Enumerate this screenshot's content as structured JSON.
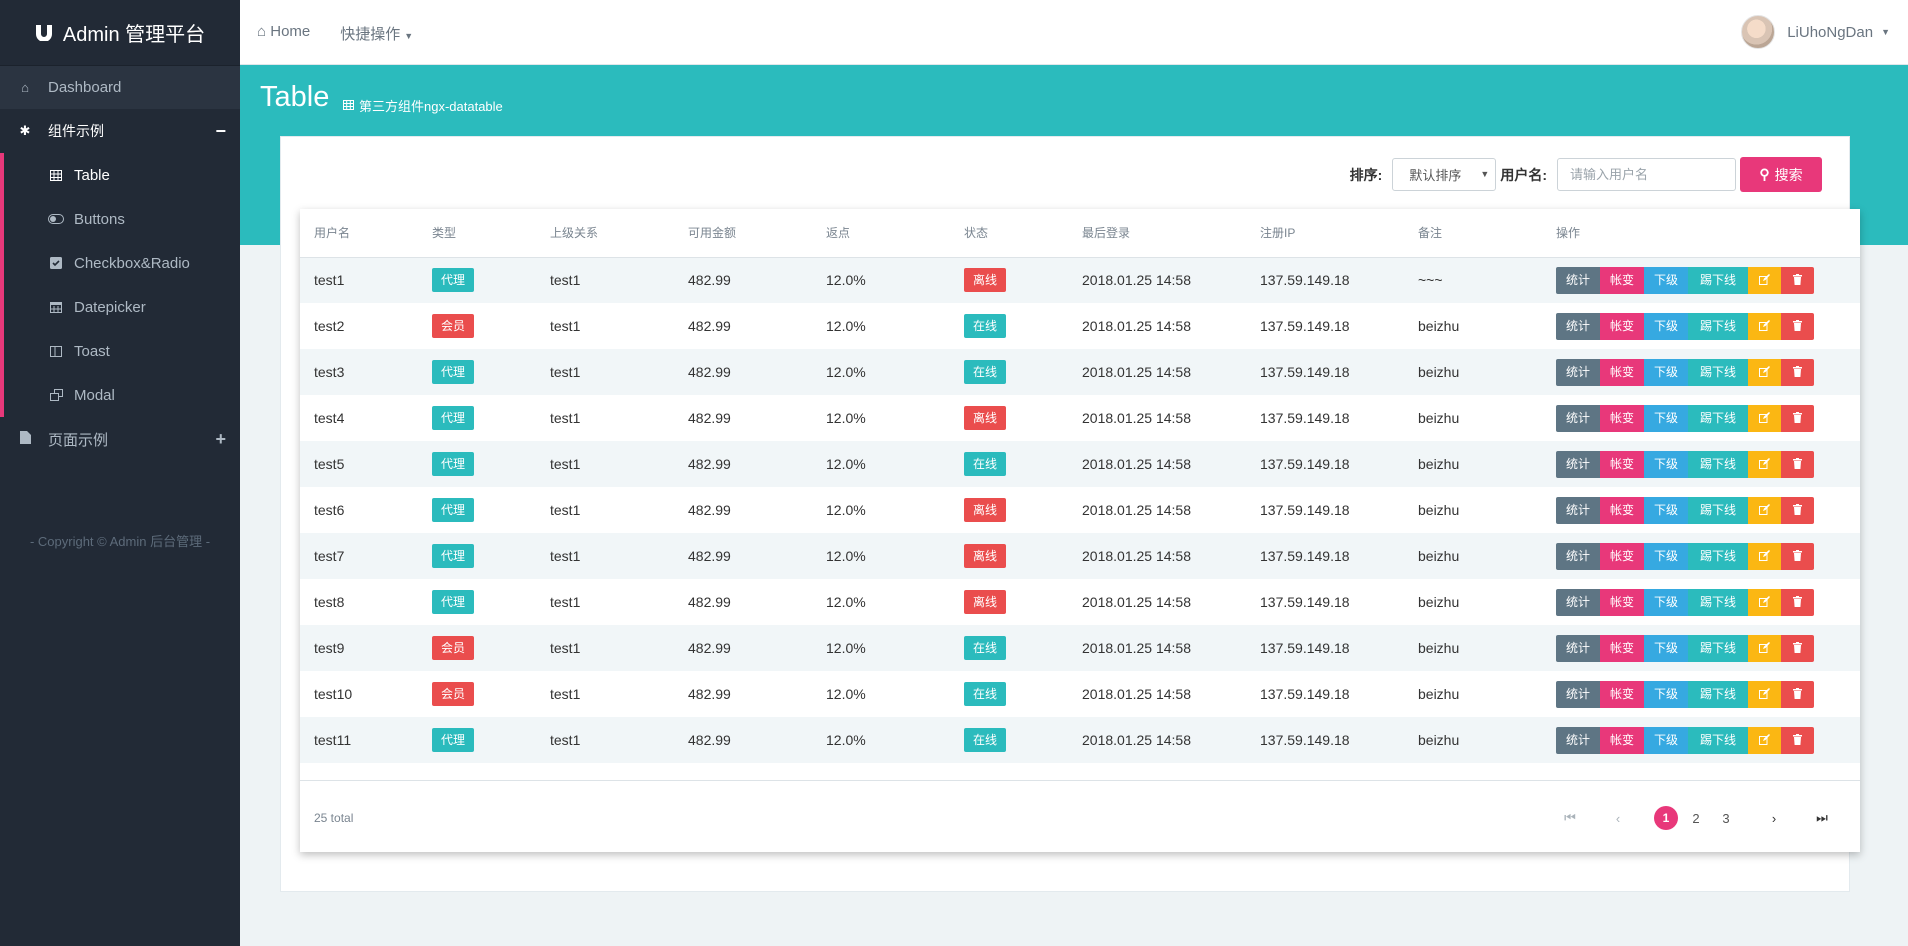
{
  "sidebar": {
    "brand": "Admin 管理平台",
    "dashboard": "Dashboard",
    "group1": "组件示例",
    "group1_toggle": "−",
    "items": [
      {
        "label": "Table",
        "icon": "table-icon"
      },
      {
        "label": "Buttons",
        "icon": "toggle-icon"
      },
      {
        "label": "Checkbox&Radio",
        "icon": "checkbox-icon"
      },
      {
        "label": "Datepicker",
        "icon": "calendar-icon"
      },
      {
        "label": "Toast",
        "icon": "columns-icon"
      },
      {
        "label": "Modal",
        "icon": "window-icon"
      }
    ],
    "group2": "页面示例",
    "group2_toggle": "+",
    "copyright": "- Copyright © Admin 后台管理 -"
  },
  "header": {
    "home": "Home",
    "quick": "快捷操作",
    "username": "LiUhoNgDan"
  },
  "page": {
    "title": "Table",
    "subtitle": "第三方组件ngx-datatable"
  },
  "toolbar": {
    "sort_label": "排序:",
    "sort_value": "默认排序",
    "user_label": "用户名:",
    "search_placeholder": "请输入用户名",
    "search_button": "搜索"
  },
  "table": {
    "headers": [
      "用户名",
      "类型",
      "上级关系",
      "可用金额",
      "返点",
      "状态",
      "最后登录",
      "注册IP",
      "备注",
      "操作"
    ],
    "ops": [
      "统计",
      "帐变",
      "下级",
      "踢下线"
    ],
    "rows": [
      {
        "user": "test1",
        "type": "代理",
        "parent": "test1",
        "amount": "482.99",
        "rebate": "12.0%",
        "status": "离线",
        "login": "2018.01.25 14:58",
        "ip": "137.59.149.18",
        "note": "~~~"
      },
      {
        "user": "test2",
        "type": "会员",
        "parent": "test1",
        "amount": "482.99",
        "rebate": "12.0%",
        "status": "在线",
        "login": "2018.01.25 14:58",
        "ip": "137.59.149.18",
        "note": "beizhu"
      },
      {
        "user": "test3",
        "type": "代理",
        "parent": "test1",
        "amount": "482.99",
        "rebate": "12.0%",
        "status": "在线",
        "login": "2018.01.25 14:58",
        "ip": "137.59.149.18",
        "note": "beizhu"
      },
      {
        "user": "test4",
        "type": "代理",
        "parent": "test1",
        "amount": "482.99",
        "rebate": "12.0%",
        "status": "离线",
        "login": "2018.01.25 14:58",
        "ip": "137.59.149.18",
        "note": "beizhu"
      },
      {
        "user": "test5",
        "type": "代理",
        "parent": "test1",
        "amount": "482.99",
        "rebate": "12.0%",
        "status": "在线",
        "login": "2018.01.25 14:58",
        "ip": "137.59.149.18",
        "note": "beizhu"
      },
      {
        "user": "test6",
        "type": "代理",
        "parent": "test1",
        "amount": "482.99",
        "rebate": "12.0%",
        "status": "离线",
        "login": "2018.01.25 14:58",
        "ip": "137.59.149.18",
        "note": "beizhu"
      },
      {
        "user": "test7",
        "type": "代理",
        "parent": "test1",
        "amount": "482.99",
        "rebate": "12.0%",
        "status": "离线",
        "login": "2018.01.25 14:58",
        "ip": "137.59.149.18",
        "note": "beizhu"
      },
      {
        "user": "test8",
        "type": "代理",
        "parent": "test1",
        "amount": "482.99",
        "rebate": "12.0%",
        "status": "离线",
        "login": "2018.01.25 14:58",
        "ip": "137.59.149.18",
        "note": "beizhu"
      },
      {
        "user": "test9",
        "type": "会员",
        "parent": "test1",
        "amount": "482.99",
        "rebate": "12.0%",
        "status": "在线",
        "login": "2018.01.25 14:58",
        "ip": "137.59.149.18",
        "note": "beizhu"
      },
      {
        "user": "test10",
        "type": "会员",
        "parent": "test1",
        "amount": "482.99",
        "rebate": "12.0%",
        "status": "在线",
        "login": "2018.01.25 14:58",
        "ip": "137.59.149.18",
        "note": "beizhu"
      },
      {
        "user": "test11",
        "type": "代理",
        "parent": "test1",
        "amount": "482.99",
        "rebate": "12.0%",
        "status": "在线",
        "login": "2018.01.25 14:58",
        "ip": "137.59.149.18",
        "note": "beizhu"
      }
    ],
    "total": "25 total",
    "pages": [
      "1",
      "2",
      "3"
    ],
    "current_page": "1"
  },
  "colors": {
    "accent": "#e8387a",
    "teal": "#2bbbbd",
    "danger": "#ea4d4d",
    "sidebar": "#222a36"
  }
}
